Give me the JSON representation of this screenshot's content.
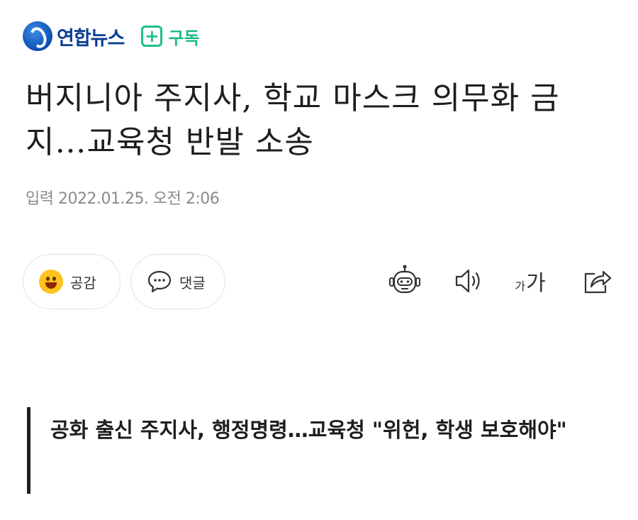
{
  "header": {
    "logo_text": "연합뉴스",
    "subscribe_label": "구독",
    "accent_color": "#1cc08a"
  },
  "article": {
    "title": "버지니아 주지사, 학교 마스크 의무화 금지…교육청 반발 소송",
    "date": "입력 2022.01.25. 오전 2:06",
    "subheadline": "공화 출신 주지사, 행정명령…교육청 \"위헌, 학생 보호해야\""
  },
  "actions": {
    "like_label": "공감",
    "comment_label": "댓글"
  },
  "toolbar": {
    "font_small": "가",
    "font_big": "가"
  },
  "icons": [
    "logo-icon",
    "plus-icon",
    "smile-emoji-icon",
    "speech-bubble-icon",
    "robot-icon",
    "speaker-icon",
    "font-size-icon",
    "share-icon"
  ]
}
